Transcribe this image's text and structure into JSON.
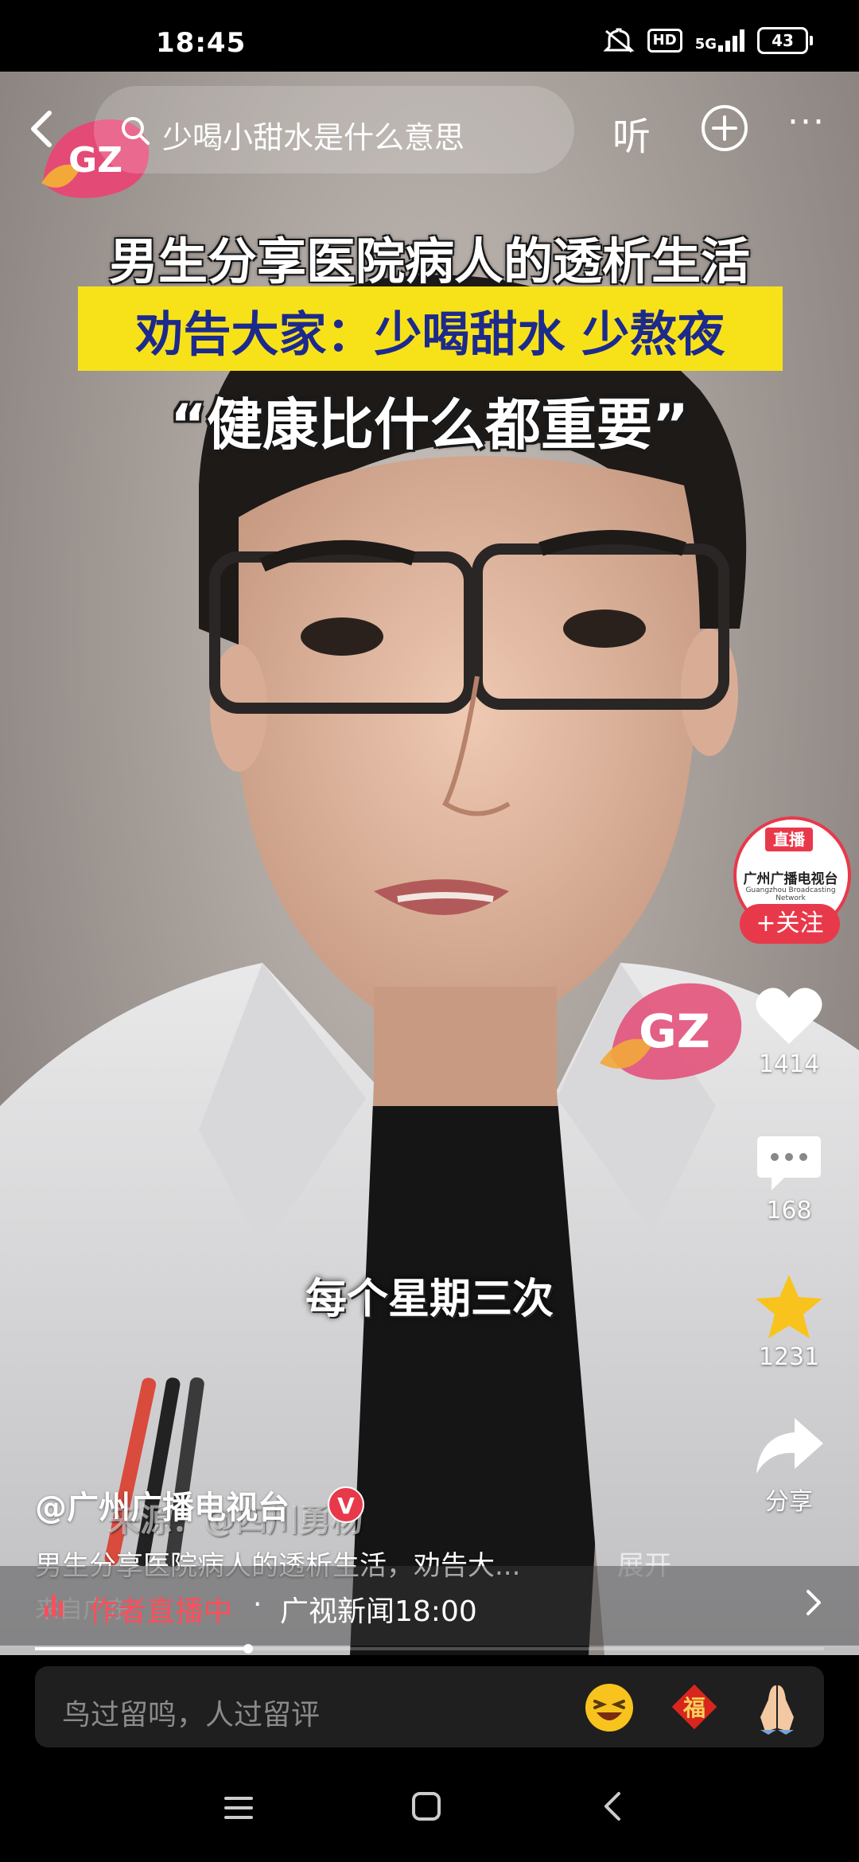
{
  "status_bar": {
    "time": "18:45",
    "hd": "HD",
    "network": "5G",
    "battery": "43"
  },
  "top_bar": {
    "search_query": "少喝小甜水是什么意思",
    "listen_label": "听"
  },
  "video": {
    "headline_1": "男生分享医院病人的透析生活",
    "headline_2": "劝告大家：少喝甜水 少熬夜",
    "headline_3": "“健康比什么都重要”",
    "subtitle": "每个星期三次",
    "source_watermark": "来源：@四川勇杨",
    "logo_text": "GZ"
  },
  "author_avatar": {
    "live_tag": "直播",
    "name": "广州广播电视台",
    "sub": "Guangzhou Broadcasting Network",
    "follow_label": "+关注"
  },
  "rail": {
    "likes": "1414",
    "comments": "168",
    "favorites": "1231",
    "share_label": "分享"
  },
  "info": {
    "author": "@广州广播电视台",
    "verified": "V",
    "description": "男生分享医院病人的透析生活，劝告大...",
    "expand_label": "展开",
    "location": "来自广东"
  },
  "live_bar": {
    "label": "作者直播中",
    "separator": "·",
    "program": "广视新闻18:00"
  },
  "progress": {
    "fraction": 0.27
  },
  "comment": {
    "placeholder": "鸟过留鸣，人过留评",
    "fu_char": "福"
  },
  "colors": {
    "accent_red": "#e8394a",
    "live_red": "#ff4d5a",
    "headline_yellow": "#f7e21a",
    "headline_blue": "#1c2a8c",
    "star_yellow": "#f8c31d"
  }
}
